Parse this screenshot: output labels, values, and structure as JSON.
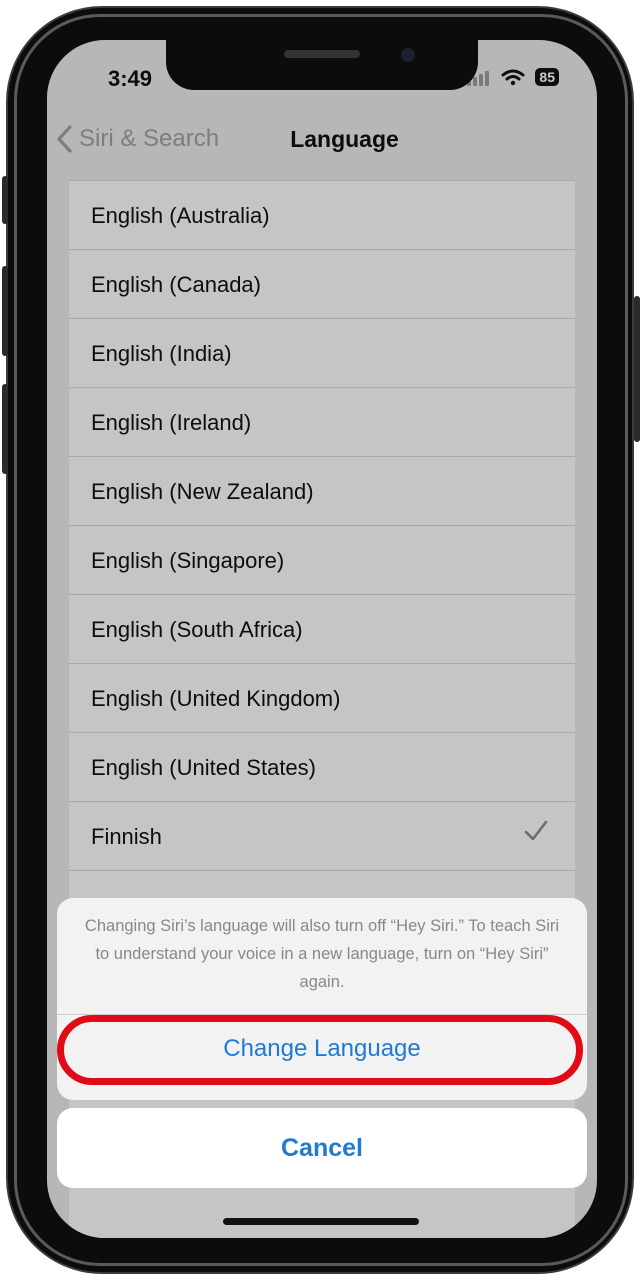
{
  "status_bar": {
    "time": "3:49",
    "battery": "85"
  },
  "nav": {
    "back_label": "Siri & Search",
    "title": "Language"
  },
  "languages": [
    {
      "label": "English (Australia)",
      "selected": false
    },
    {
      "label": "English (Canada)",
      "selected": false
    },
    {
      "label": "English (India)",
      "selected": false
    },
    {
      "label": "English (Ireland)",
      "selected": false
    },
    {
      "label": "English (New Zealand)",
      "selected": false
    },
    {
      "label": "English (Singapore)",
      "selected": false
    },
    {
      "label": "English (South Africa)",
      "selected": false
    },
    {
      "label": "English (United Kingdom)",
      "selected": false
    },
    {
      "label": "English (United States)",
      "selected": false
    },
    {
      "label": "Finnish",
      "selected": true
    }
  ],
  "action_sheet": {
    "message": "Changing Siri’s language will also turn off “Hey Siri.” To teach Siri to understand your voice in a new language, turn on “Hey Siri” again.",
    "confirm_label": "Change Language",
    "cancel_label": "Cancel"
  },
  "colors": {
    "accent": "#1f7ad6",
    "highlight": "#e00b16"
  }
}
